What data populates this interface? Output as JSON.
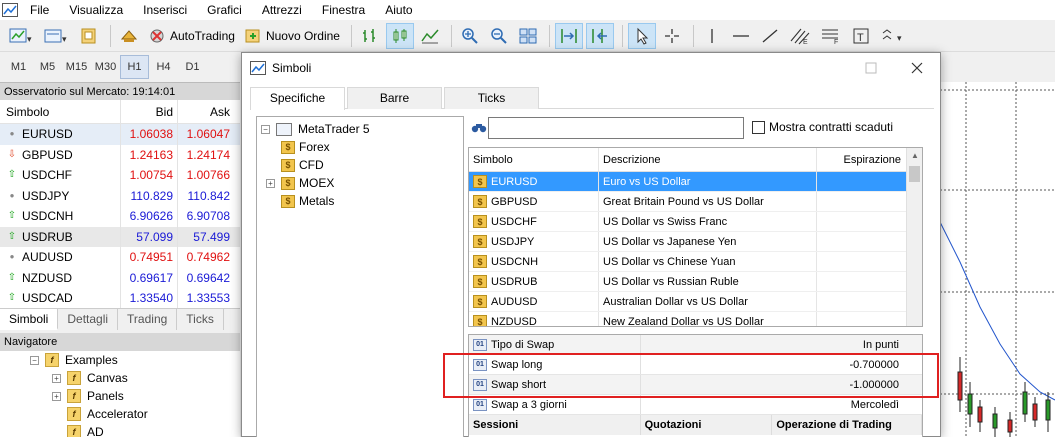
{
  "menu": {
    "items": [
      "File",
      "Visualizza",
      "Inserisci",
      "Grafici",
      "Attrezzi",
      "Finestra",
      "Aiuto"
    ]
  },
  "toolbar": {
    "autotrading_label": "AutoTrading",
    "new_order_label": "Nuovo Ordine"
  },
  "timeframes": [
    "M1",
    "M5",
    "M15",
    "M30",
    "H1",
    "H4",
    "D1"
  ],
  "timeframe_active": "H1",
  "market_watch": {
    "title": "Osservatorio sul Mercato: 19:14:01",
    "col_symbol": "Simbolo",
    "col_bid": "Bid",
    "col_ask": "Ask",
    "rows": [
      {
        "symbol": "EURUSD",
        "bid": "1.06038",
        "ask": "1.06047",
        "dir": "neutral"
      },
      {
        "symbol": "GBPUSD",
        "bid": "1.24163",
        "ask": "1.24174",
        "dir": "down"
      },
      {
        "symbol": "USDCHF",
        "bid": "1.00754",
        "ask": "1.00766",
        "dir": "up"
      },
      {
        "symbol": "USDJPY",
        "bid": "110.829",
        "ask": "110.842",
        "dir": "neutral"
      },
      {
        "symbol": "USDCNH",
        "bid": "6.90626",
        "ask": "6.90708",
        "dir": "up"
      },
      {
        "symbol": "USDRUB",
        "bid": "57.099",
        "ask": "57.499",
        "dir": "up"
      },
      {
        "symbol": "AUDUSD",
        "bid": "0.74951",
        "ask": "0.74962",
        "dir": "neutral"
      },
      {
        "symbol": "NZDUSD",
        "bid": "0.69617",
        "ask": "0.69642",
        "dir": "up"
      },
      {
        "symbol": "USDCAD",
        "bid": "1.33540",
        "ask": "1.33553",
        "dir": "up"
      }
    ],
    "tabs": [
      "Simboli",
      "Dettagli",
      "Trading",
      "Ticks"
    ]
  },
  "navigator": {
    "title": "Navigatore",
    "items": [
      "Examples",
      "Canvas",
      "Panels",
      "Accelerator",
      "AD"
    ]
  },
  "dialog": {
    "title": "Simboli",
    "tabs": [
      "Specifiche",
      "Barre",
      "Ticks"
    ],
    "tree": {
      "root": "MetaTrader 5",
      "children": [
        "Forex",
        "CFD",
        "MOEX",
        "Metals"
      ]
    },
    "search": {
      "value": ""
    },
    "show_expired_label": "Mostra contratti scaduti",
    "symbols_table": {
      "col_symbol": "Simbolo",
      "col_description": "Descrizione",
      "col_expiration": "Espirazione",
      "rows": [
        {
          "symbol": "EURUSD",
          "description": "Euro vs US Dollar"
        },
        {
          "symbol": "GBPUSD",
          "description": "Great Britain Pound vs US Dollar"
        },
        {
          "symbol": "USDCHF",
          "description": "US Dollar vs Swiss Franc"
        },
        {
          "symbol": "USDJPY",
          "description": "US Dollar vs Japanese Yen"
        },
        {
          "symbol": "USDCNH",
          "description": "US Dollar vs Chinese Yuan"
        },
        {
          "symbol": "USDRUB",
          "description": "US Dollar vs Russian Ruble"
        },
        {
          "symbol": "AUDUSD",
          "description": "Australian Dollar vs US Dollar"
        },
        {
          "symbol": "NZDUSD",
          "description": "New Zealand Dollar vs US Dollar"
        }
      ]
    },
    "properties": [
      {
        "name": "Tipo di Swap",
        "value": "In punti"
      },
      {
        "name": "Swap long",
        "value": "-0.700000"
      },
      {
        "name": "Swap short",
        "value": "-1.000000"
      },
      {
        "name": "Swap a 3 giorni",
        "value": "Mercoledì"
      }
    ],
    "sessions_header": [
      "Sessioni",
      "Quotazioni",
      "Operazione di Trading"
    ]
  },
  "colors": {
    "selection": "#3399ff",
    "highlight": "#e02020",
    "bid_up": "#1a1ad6",
    "bid_down": "#e01010"
  }
}
